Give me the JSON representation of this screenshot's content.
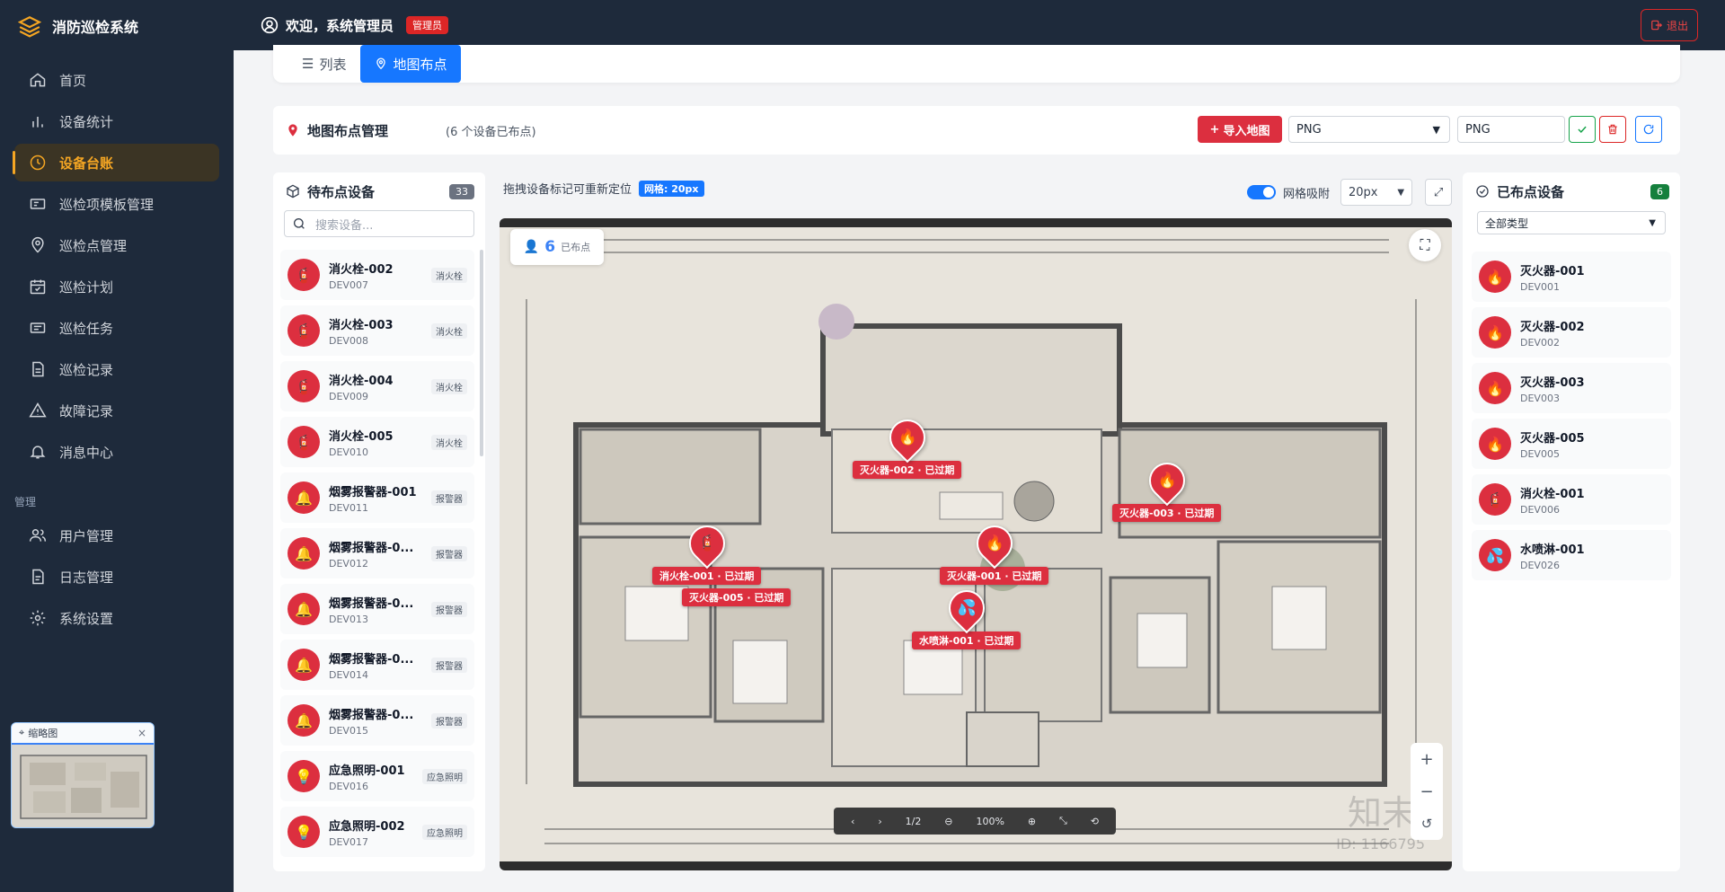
{
  "app": {
    "title": "消防巡检系统"
  },
  "topbar": {
    "welcome": "欢迎，系统管理员",
    "role": "管理员",
    "logout": "退出"
  },
  "nav": {
    "items": [
      {
        "label": "首页",
        "icon": "home-icon"
      },
      {
        "label": "设备统计",
        "icon": "bar-chart-icon"
      },
      {
        "label": "设备台账",
        "icon": "clock-icon",
        "active": true
      },
      {
        "label": "巡检项模板管理",
        "icon": "template-icon"
      },
      {
        "label": "巡检点管理",
        "icon": "location-icon"
      },
      {
        "label": "巡检计划",
        "icon": "calendar-icon"
      },
      {
        "label": "巡检任务",
        "icon": "task-icon"
      },
      {
        "label": "巡检记录",
        "icon": "document-icon"
      },
      {
        "label": "故障记录",
        "icon": "warning-icon"
      },
      {
        "label": "消息中心",
        "icon": "bell-icon"
      }
    ],
    "section": "管理",
    "admin_items": [
      {
        "label": "用户管理",
        "icon": "users-icon"
      },
      {
        "label": "日志管理",
        "icon": "log-icon"
      },
      {
        "label": "系统设置",
        "icon": "gear-icon"
      }
    ]
  },
  "minimap": {
    "title": "缩略图",
    "close": "×"
  },
  "tabs": [
    {
      "label": "列表",
      "icon": "list-icon"
    },
    {
      "label": "地图布点",
      "icon": "pin-icon",
      "active": true
    }
  ],
  "toolbar": {
    "title": "地图布点管理",
    "count": "(6 个设备已布点)",
    "import_label": "导入地图",
    "map_select": "PNG",
    "name_input": "PNG"
  },
  "left_panel": {
    "title": "待布点设备",
    "count": "33",
    "search_placeholder": "搜索设备...",
    "devices": [
      {
        "name": "消火栓-002",
        "code": "DEV007",
        "type": "消火栓",
        "icon": "🧯"
      },
      {
        "name": "消火栓-003",
        "code": "DEV008",
        "type": "消火栓",
        "icon": "🧯"
      },
      {
        "name": "消火栓-004",
        "code": "DEV009",
        "type": "消火栓",
        "icon": "🧯"
      },
      {
        "name": "消火栓-005",
        "code": "DEV010",
        "type": "消火栓",
        "icon": "🧯"
      },
      {
        "name": "烟雾报警器-001",
        "code": "DEV011",
        "type": "报警器",
        "icon": "🔔"
      },
      {
        "name": "烟雾报警器-0...",
        "code": "DEV012",
        "type": "报警器",
        "icon": "🔔"
      },
      {
        "name": "烟雾报警器-0...",
        "code": "DEV013",
        "type": "报警器",
        "icon": "🔔"
      },
      {
        "name": "烟雾报警器-0...",
        "code": "DEV014",
        "type": "报警器",
        "icon": "🔔"
      },
      {
        "name": "烟雾报警器-0...",
        "code": "DEV015",
        "type": "报警器",
        "icon": "🔔"
      },
      {
        "name": "应急照明-001",
        "code": "DEV016",
        "type": "应急照明",
        "icon": "💡"
      },
      {
        "name": "应急照明-002",
        "code": "DEV017",
        "type": "应急照明",
        "icon": "💡"
      }
    ]
  },
  "map": {
    "hint": "拖拽设备标记可重新定位",
    "grid_badge": "网格: 20px",
    "snap_label": "网格吸附",
    "snap_value": "20px",
    "placed_count": "6",
    "placed_label": "已布点",
    "page": "1/2",
    "zoom": "100%",
    "watermark": "知末",
    "watermark_id": "ID: 1166795",
    "markers": [
      {
        "label": "灭火器-002 · 已过期",
        "icon": "🔥"
      },
      {
        "label": "灭火器-003 · 已过期",
        "icon": "🔥"
      },
      {
        "label": "消火栓-001 · 已过期",
        "icon": "🧯"
      },
      {
        "label": "灭火器-005 · 已过期",
        "icon": "🔥"
      },
      {
        "label": "灭火器-001 · 已过期",
        "icon": "🔥"
      },
      {
        "label": "水喷淋-001 · 已过期",
        "icon": "💦"
      }
    ]
  },
  "right_panel": {
    "title": "已布点设备",
    "count": "6",
    "filter": "全部类型",
    "devices": [
      {
        "name": "灭火器-001",
        "code": "DEV001",
        "icon": "🔥"
      },
      {
        "name": "灭火器-002",
        "code": "DEV002",
        "icon": "🔥"
      },
      {
        "name": "灭火器-003",
        "code": "DEV003",
        "icon": "🔥"
      },
      {
        "name": "灭火器-005",
        "code": "DEV005",
        "icon": "🔥"
      },
      {
        "name": "消火栓-001",
        "code": "DEV006",
        "icon": "🧯"
      },
      {
        "name": "水喷淋-001",
        "code": "DEV026",
        "icon": "💦"
      }
    ]
  },
  "colors": {
    "accent": "#1677ff",
    "danger": "#dc2f3f",
    "sidebar": "#1e2a3b",
    "active": "#f5a623"
  }
}
